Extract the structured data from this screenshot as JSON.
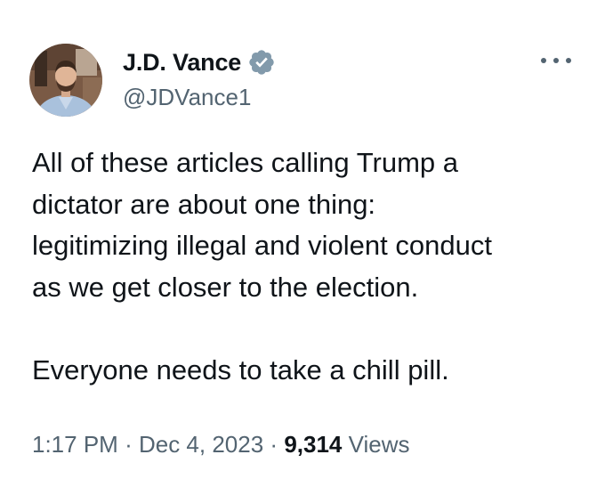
{
  "author": {
    "display_name": "J.D. Vance",
    "handle": "@JDVance1",
    "verified_icon": "verified-badge-icon",
    "avatar_icon": "avatar-photo"
  },
  "menu": {
    "more_icon": "more-horizontal-icon"
  },
  "tweet": {
    "paragraphs": [
      "All of these articles calling Trump a\ndictator are about one thing:\nlegitimizing illegal and violent conduct\nas we get closer to the election.",
      "Everyone needs to take a chill pill."
    ]
  },
  "meta": {
    "time": "1:17 PM",
    "separator": "·",
    "date": "Dec 4, 2023",
    "views_count": "9,314",
    "views_label": "Views"
  },
  "colors": {
    "text": "#0f1419",
    "secondary": "#536471",
    "verified_badge": "#829aab"
  }
}
